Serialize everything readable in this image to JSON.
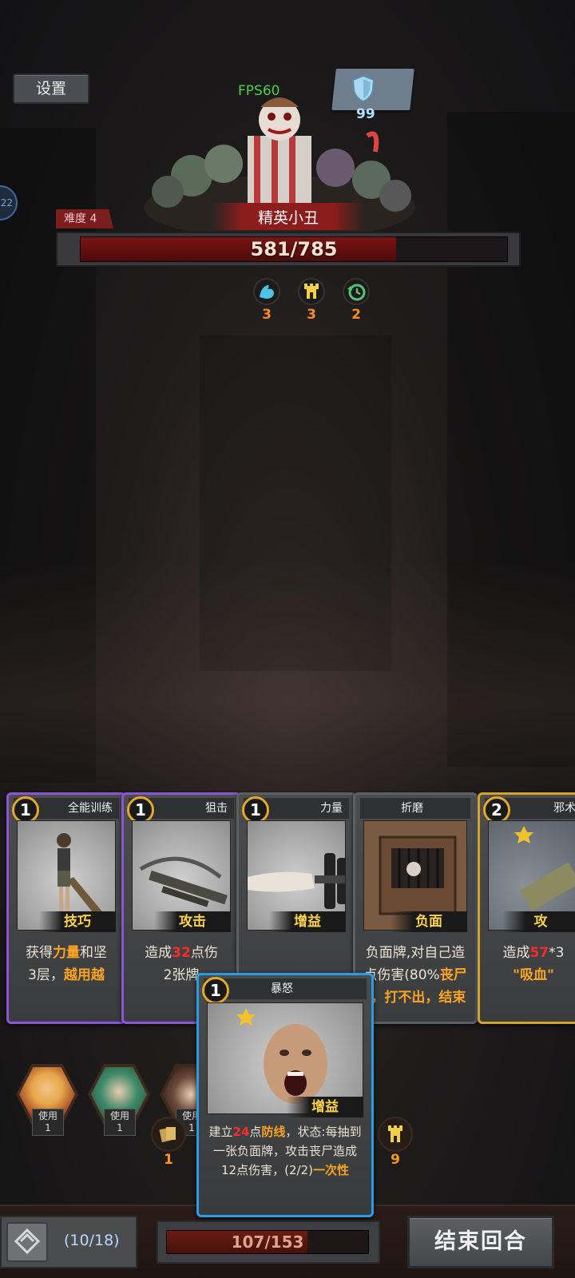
{
  "hud": {
    "settings_label": "设置",
    "side_tab_value": "22",
    "fps": "FPS60",
    "armor_value": "99"
  },
  "enemy": {
    "difficulty_label": "难度 4",
    "name": "精英小丑",
    "hp_text": "581/785",
    "hp_current": 581,
    "hp_max": 785,
    "statuses": [
      {
        "icon": "strength-icon",
        "value": "3",
        "color": "#4fc3e6"
      },
      {
        "icon": "fortification-icon",
        "value": "3",
        "color": "#f2d04a"
      },
      {
        "icon": "regeneration-icon",
        "value": "2",
        "color": "#55c271"
      }
    ]
  },
  "hand": [
    {
      "cost": "1",
      "title": "全能训练",
      "type": "技巧",
      "desc_prefix": "获得",
      "desc_hl1": "力量",
      "desc_mid": "和坚",
      "desc2_prefix": "3层，",
      "desc2_hl": "越用越"
    },
    {
      "cost": "1",
      "title": "狙击",
      "type": "攻击",
      "desc_prefix": "造成",
      "desc_hl1": "32",
      "desc_mid": "点伤",
      "desc2_prefix": "2张牌",
      "desc2_hl": ""
    },
    {
      "cost": "1",
      "title": "力量",
      "type": "增益"
    },
    {
      "cost": "",
      "title": "折磨",
      "type": "负面",
      "desc_line1": "负面牌,对自己造",
      "desc_line2a": "点伤害(80%",
      "desc_line2b": "丧尸",
      "desc_line3a": ")，",
      "desc_line3b": "打不出，结束"
    },
    {
      "cost": "2",
      "title": "邪术",
      "type": "攻",
      "desc_prefix": "造成",
      "desc_hl1": "57",
      "desc_mid": "*3",
      "desc2_hl": "\"吸血\""
    }
  ],
  "selected_card": {
    "cost": "1",
    "title": "暴怒",
    "type": "增益",
    "desc_a": "建立",
    "desc_num": "24",
    "desc_b": "点",
    "desc_kw": "防线",
    "desc_c": "，状态:每抽到一张负面牌，攻击丧尸造成12点伤害，(2/2)",
    "desc_once": "一次性"
  },
  "heroes": [
    {
      "use_label": "使用",
      "use_count": "1",
      "skin": "#e8a84a"
    },
    {
      "use_label": "使用",
      "use_count": "1",
      "skin": "#3f8a6a"
    },
    {
      "use_label": "使用",
      "use_count": "1",
      "skin": "#6b4a3a"
    }
  ],
  "resources": {
    "cards_icon": "cards-icon",
    "cards_value": "1",
    "tower_icon": "tower-icon",
    "tower_value": "9"
  },
  "bottom": {
    "deck_count": "(10/18)",
    "energy_text": "107/153",
    "energy_current": 107,
    "energy_max": 153,
    "end_turn_label": "结束回合"
  }
}
